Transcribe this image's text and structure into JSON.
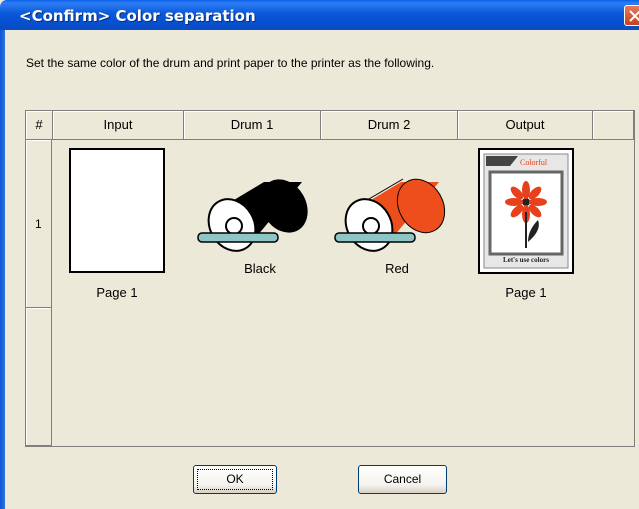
{
  "window": {
    "title": "<Confirm> Color separation"
  },
  "instruction": "Set the same color of the drum and print paper to the printer as the following.",
  "table": {
    "headers": [
      "#",
      "Input",
      "Drum 1",
      "Drum 2",
      "Output"
    ],
    "rows": [
      {
        "number": "1",
        "input_caption": "Page 1",
        "drum1_caption": "Black",
        "drum2_caption": "Red",
        "output_caption": "Page 1"
      }
    ]
  },
  "output_art": {
    "header_text": "Colorful",
    "footer_text": "Let's use colors"
  },
  "buttons": {
    "ok": "OK",
    "cancel": "Cancel"
  },
  "colors": {
    "titlebar": "#0b58d8",
    "drum1": "#000000",
    "drum2": "#ee4e1c",
    "dialog_bg": "#ece9d8"
  },
  "icons": [
    "close-icon",
    "drum-black-icon",
    "drum-red-icon",
    "flower-icon"
  ]
}
